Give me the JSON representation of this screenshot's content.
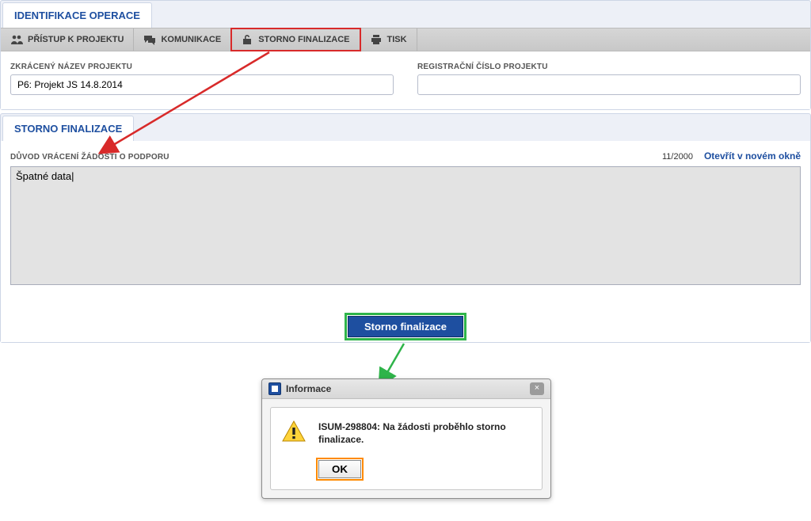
{
  "header": {
    "tab_title": "IDENTIFIKACE OPERACE"
  },
  "toolbar": {
    "items": [
      {
        "label": "PŘÍSTUP K PROJEKTU",
        "icon": "people-icon"
      },
      {
        "label": "KOMUNIKACE",
        "icon": "chat-icon"
      },
      {
        "label": "STORNO FINALIZACE",
        "icon": "lock-open-icon"
      },
      {
        "label": "TISK",
        "icon": "printer-icon"
      }
    ]
  },
  "fields": {
    "short_name_label": "ZKRÁCENÝ NÁZEV PROJEKTU",
    "short_name_value": "P6: Projekt JS 14.8.2014",
    "reg_no_label": "REGISTRAČNÍ ČÍSLO PROJEKTU",
    "reg_no_value": ""
  },
  "storno": {
    "panel_title": "STORNO FINALIZACE",
    "reason_label": "DŮVOD VRÁCENÍ ŽÁDOSTI O PODPORU",
    "reason_value": "Špatné data|",
    "counter": "11/2000",
    "open_in_new": "Otevřít v novém okně",
    "button": "Storno finalizace"
  },
  "dialog": {
    "title": "Informace",
    "message": "ISUM-298804: Na žádosti proběhlo storno finalizace.",
    "ok": "OK",
    "close_glyph": "×"
  }
}
